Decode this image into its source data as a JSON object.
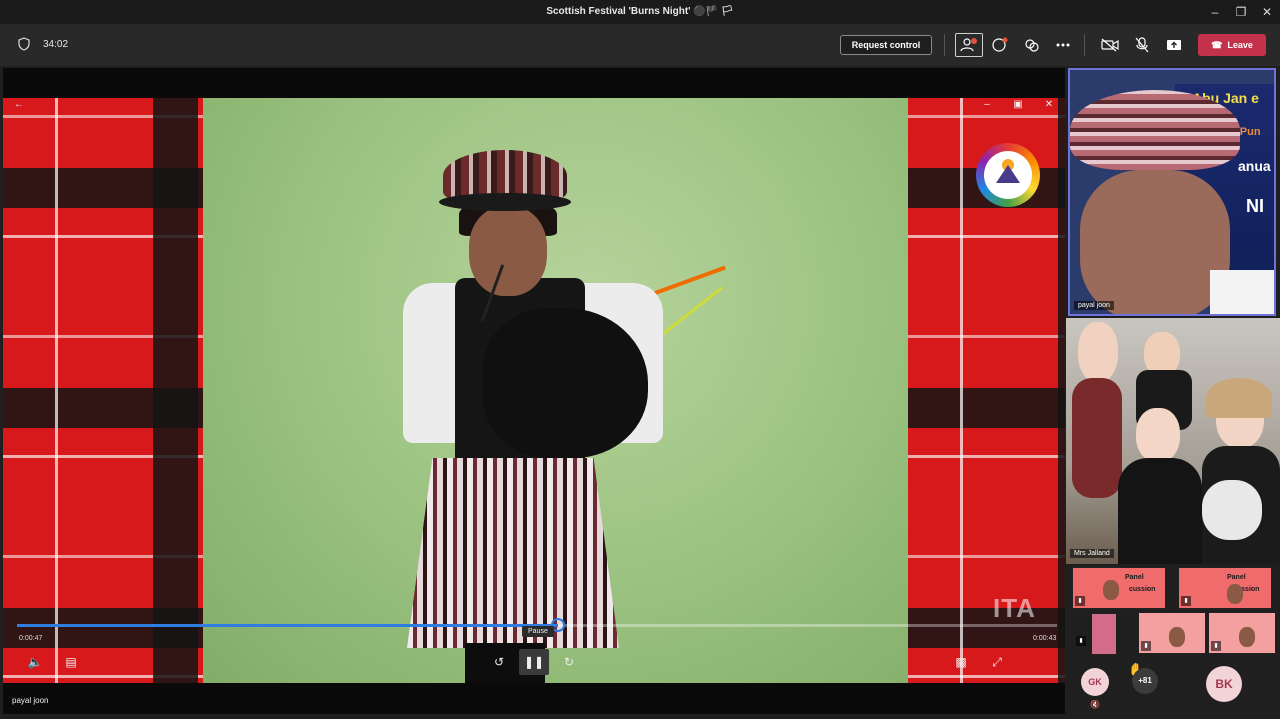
{
  "window": {
    "title": "Scottish Festival 'Burns Night' ⚫🏴 🏳"
  },
  "toolbar": {
    "timer": "34:02",
    "request_control_label": "Request control",
    "participants_badge": "3",
    "leave_label": "Leave"
  },
  "stage": {
    "presenter_name": "payal joon",
    "time_elapsed": "0:00:47",
    "time_total": "0:00:43",
    "progress": 0.52,
    "tooltip": "Pause",
    "watermark_text": "ITA"
  },
  "panel": {
    "tile1_name": "payal joon",
    "tile1_sign_lines": [
      "Abu Jan e",
      "h Pun",
      "anua",
      "NI"
    ],
    "tile2_name": "Mrs Jalland",
    "mini_labels": [
      "Panel",
      "cussion",
      "Panel",
      "cussion"
    ],
    "avatars": [
      {
        "initials": "GK",
        "bg": "#f2d3d8",
        "fg": "#a3394e"
      },
      {
        "initials": "+81",
        "bg": "#3b3b3b",
        "fg": "#ffffff"
      },
      {
        "initials": "BK",
        "bg": "#f2d3d8",
        "fg": "#a3394e"
      }
    ]
  },
  "colors": {
    "accent": "#6f72d6",
    "leave": "#c4314b",
    "progress": "#2f7de1"
  }
}
